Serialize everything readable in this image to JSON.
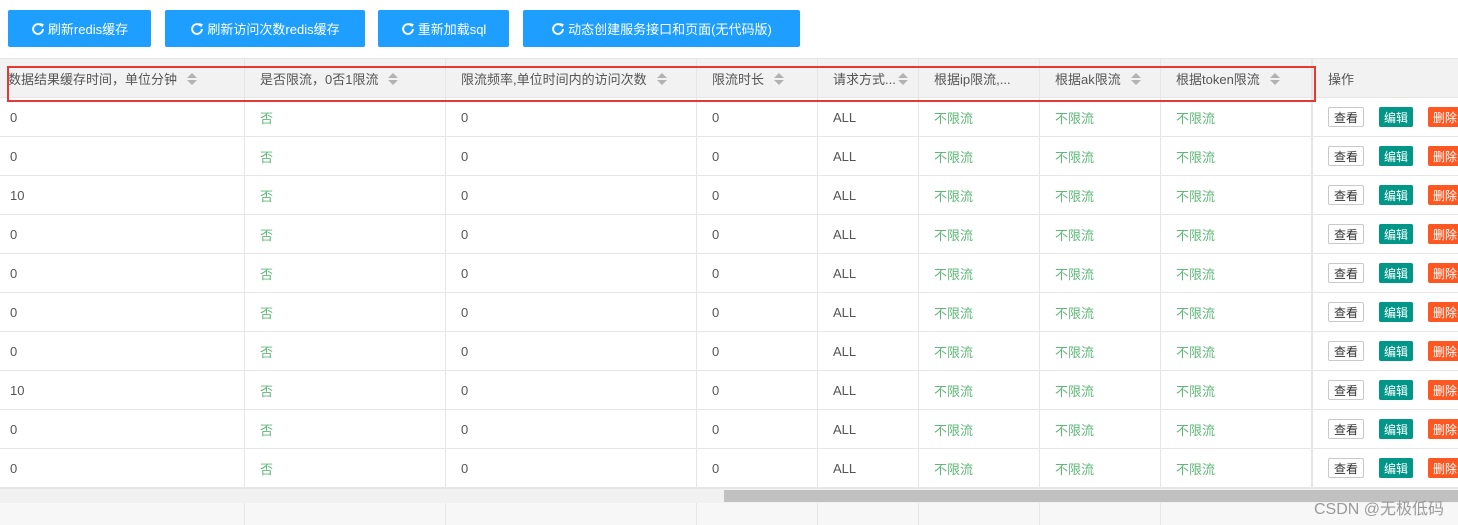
{
  "toolbar": {
    "buttons": [
      {
        "label": "刷新redis缓存",
        "icon": "refresh-icon"
      },
      {
        "label": "刷新访问次数redis缓存",
        "icon": "refresh-icon"
      },
      {
        "label": "重新加载sql",
        "icon": "refresh-icon"
      },
      {
        "label": "动态创建服务接口和页面(无代码版)",
        "icon": "refresh-icon"
      }
    ]
  },
  "colors": {
    "primary": "#1E9FFF",
    "edit": "#009688",
    "delete": "#FF5722",
    "positive_text": "#5FB878",
    "highlight_box": "#e53935"
  },
  "table": {
    "columns": [
      {
        "label": "数据结果缓存时间，单位分钟",
        "sortable": true
      },
      {
        "label": "是否限流，0否1限流",
        "sortable": true
      },
      {
        "label": "限流频率,单位时间内的访问次数",
        "sortable": true
      },
      {
        "label": "限流时长",
        "sortable": true
      },
      {
        "label": "请求方式...",
        "sortable": true
      },
      {
        "label": "根据ip限流,...",
        "sortable": false
      },
      {
        "label": "根据ak限流",
        "sortable": true
      },
      {
        "label": "根据token限流",
        "sortable": true
      },
      {
        "label": "操作",
        "sortable": false
      }
    ],
    "actions": {
      "view": "查看",
      "edit": "编辑",
      "delete": "删除"
    },
    "rows": [
      [
        "0",
        "否",
        "0",
        "0",
        "ALL",
        "不限流",
        "不限流",
        "不限流"
      ],
      [
        "0",
        "否",
        "0",
        "0",
        "ALL",
        "不限流",
        "不限流",
        "不限流"
      ],
      [
        "10",
        "否",
        "0",
        "0",
        "ALL",
        "不限流",
        "不限流",
        "不限流"
      ],
      [
        "0",
        "否",
        "0",
        "0",
        "ALL",
        "不限流",
        "不限流",
        "不限流"
      ],
      [
        "0",
        "否",
        "0",
        "0",
        "ALL",
        "不限流",
        "不限流",
        "不限流"
      ],
      [
        "0",
        "否",
        "0",
        "0",
        "ALL",
        "不限流",
        "不限流",
        "不限流"
      ],
      [
        "0",
        "否",
        "0",
        "0",
        "ALL",
        "不限流",
        "不限流",
        "不限流"
      ],
      [
        "10",
        "否",
        "0",
        "0",
        "ALL",
        "不限流",
        "不限流",
        "不限流"
      ],
      [
        "0",
        "否",
        "0",
        "0",
        "ALL",
        "不限流",
        "不限流",
        "不限流"
      ],
      [
        "0",
        "否",
        "0",
        "0",
        "ALL",
        "不限流",
        "不限流",
        "不限流"
      ]
    ]
  },
  "watermark": "CSDN @无极低码"
}
